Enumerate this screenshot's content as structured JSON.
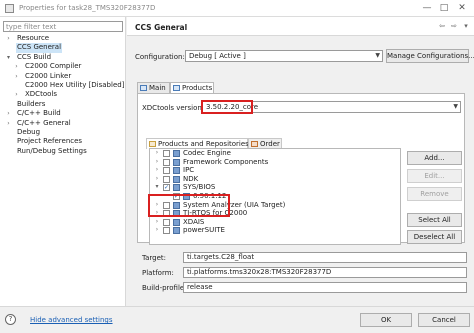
{
  "window": {
    "title": "Properties for task28_TMS320F28377D",
    "controls": [
      "—",
      "□",
      "✕"
    ]
  },
  "sidebar": {
    "filter_placeholder": "type filter text",
    "items": [
      {
        "label": "Resource",
        "expandable": true,
        "expanded": false,
        "depth": 0
      },
      {
        "label": "CCS General",
        "expandable": false,
        "depth": 0,
        "selected": true
      },
      {
        "label": "CCS Build",
        "expandable": true,
        "expanded": true,
        "depth": 0
      },
      {
        "label": "C2000 Compiler",
        "expandable": true,
        "expanded": false,
        "depth": 1
      },
      {
        "label": "C2000 Linker",
        "expandable": true,
        "expanded": false,
        "depth": 1
      },
      {
        "label": "C2000 Hex Utility  [Disabled]",
        "expandable": false,
        "depth": 1
      },
      {
        "label": "XDCtools",
        "expandable": true,
        "expanded": false,
        "depth": 1
      },
      {
        "label": "Builders",
        "expandable": false,
        "depth": 0
      },
      {
        "label": "C/C++ Build",
        "expandable": true,
        "expanded": false,
        "depth": 0
      },
      {
        "label": "C/C++ General",
        "expandable": true,
        "expanded": false,
        "depth": 0
      },
      {
        "label": "Debug",
        "expandable": false,
        "depth": 0
      },
      {
        "label": "Project References",
        "expandable": false,
        "depth": 0
      },
      {
        "label": "Run/Debug Settings",
        "expandable": false,
        "depth": 0
      }
    ]
  },
  "main": {
    "title": "CCS General",
    "configuration_label": "Configuration:",
    "configuration_value": "Debug  [ Active ]",
    "manage_button": "Manage Configurations...",
    "tabs": [
      {
        "label": "Main",
        "active": false
      },
      {
        "label": "Products",
        "active": true
      }
    ],
    "xdctools_label": "XDCtools version:",
    "xdctools_value": "3.50.2.20_core",
    "subtabs": [
      {
        "label": "Products and Repositories",
        "active": true
      },
      {
        "label": "Order",
        "active": false
      }
    ],
    "products": [
      {
        "label": "Codec Engine",
        "expandable": true,
        "checked": false,
        "depth": 0
      },
      {
        "label": "Framework Components",
        "expandable": true,
        "checked": false,
        "depth": 0
      },
      {
        "label": "IPC",
        "expandable": true,
        "checked": false,
        "depth": 0
      },
      {
        "label": "NDK",
        "expandable": true,
        "checked": false,
        "depth": 0
      },
      {
        "label": "SYS/BIOS",
        "expandable": true,
        "expanded": true,
        "checked": true,
        "depth": 0
      },
      {
        "label": "6.50.1.12",
        "expandable": false,
        "checked": true,
        "depth": 1
      },
      {
        "label": "System Analyzer (UIA Target)",
        "expandable": true,
        "checked": false,
        "depth": 0
      },
      {
        "label": "TI-RTOS for C2000",
        "expandable": true,
        "checked": false,
        "depth": 0
      },
      {
        "label": "XDAIS",
        "expandable": true,
        "checked": false,
        "depth": 0
      },
      {
        "label": "powerSUITE",
        "expandable": true,
        "checked": false,
        "depth": 0
      }
    ],
    "buttons": {
      "add": "Add...",
      "edit": "Edit...",
      "remove": "Remove",
      "select_all": "Select All",
      "deselect_all": "Deselect All"
    },
    "target_label": "Target:",
    "target_value": "ti.targets.C28_float",
    "platform_label": "Platform:",
    "platform_value": "ti.platforms.tms320x28:TMS320F28377D",
    "build_profile_label": "Build-profile:",
    "build_profile_value": "release"
  },
  "footer": {
    "help_icon": "?",
    "link": "Hide advanced settings",
    "ok": "OK",
    "cancel": "Cancel"
  },
  "colors": {
    "highlight": "#d92020",
    "selection": "#cce4f7",
    "link": "#1a5fb4"
  }
}
